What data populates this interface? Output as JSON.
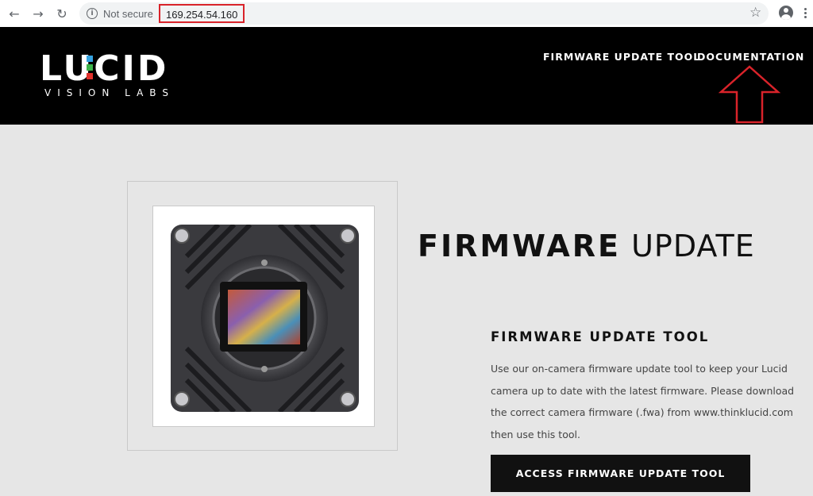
{
  "browser": {
    "back_icon": "arrow-left-icon",
    "forward_icon": "arrow-right-icon",
    "reload_icon": "reload-icon",
    "security_label": "Not secure",
    "url": "169.254.54.160",
    "annotation_color": "#d9232a"
  },
  "header": {
    "logo_text": "LUCID",
    "logo_subtext": "VISION LABS",
    "nav": {
      "firmware_tool": "FIRMWARE UPDATE TOOL",
      "documentation": "DOCUMENTATION"
    }
  },
  "main": {
    "title_bold": "FIRMWARE",
    "title_light": "UPDATE",
    "tool_heading": "FIRMWARE UPDATE TOOL",
    "tool_description": "Use our on-camera firmware update tool to keep your Lucid camera up to date with the latest firmware. Please download the correct camera firmware (.fwa) from www.thinklucid.com then use this tool.",
    "cta_label": "ACCESS FIRMWARE UPDATE TOOL"
  }
}
